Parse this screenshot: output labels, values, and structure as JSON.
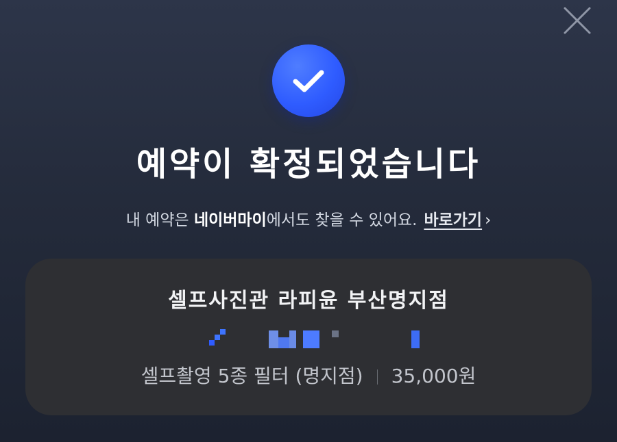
{
  "header": {
    "close_icon": "close-icon",
    "status_icon": "check-circle-icon",
    "accent_color": "#2f5cff",
    "title": "예약이 확정되었습니다"
  },
  "info": {
    "text_prefix": "내 예약은 ",
    "brand": "네이버마이",
    "text_suffix": "에서도 찾을 수 있어요.",
    "link_label": "바로가기",
    "link_chevron": "›"
  },
  "booking": {
    "store_name": "셀프사진관 라피윤 부산명지점",
    "datetime_redacted": "redacted",
    "product": "셀프촬영 5종 필터 (명지점)",
    "price": "35,000원"
  }
}
